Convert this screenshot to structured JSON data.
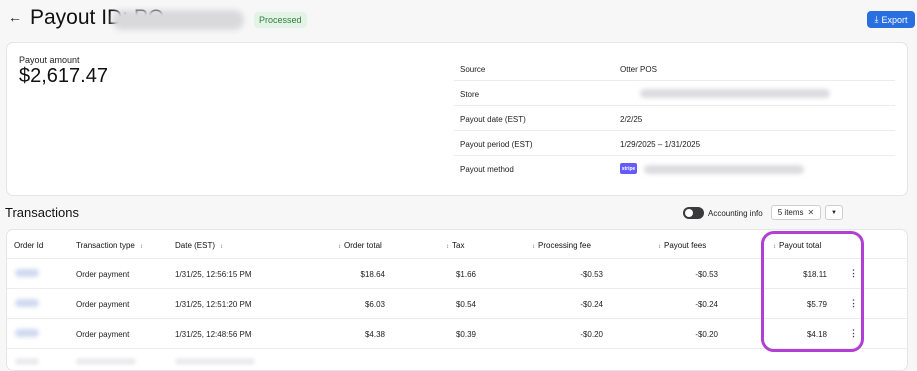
{
  "header": {
    "back_icon": "arrow-left-icon",
    "title": "Payout ID: PO-",
    "status_badge": "Processed",
    "export_label": "Export",
    "export_icon": "download-icon"
  },
  "summary": {
    "amount_label": "Payout amount",
    "amount_value": "$2,617.47",
    "details": [
      {
        "label": "Source",
        "value": "Otter POS"
      },
      {
        "label": "Store",
        "value": ""
      },
      {
        "label": "Payout date (EST)",
        "value": "2/2/25"
      },
      {
        "label": "Payout period (EST)",
        "value": "1/29/2025 – 1/31/2025"
      },
      {
        "label": "Payout method",
        "value": "",
        "logo": "stripe"
      }
    ]
  },
  "transactions": {
    "title": "Transactions",
    "accounting_info_label": "Accounting info",
    "items_chip": "5 items",
    "columns": [
      "Order Id",
      "Transaction type",
      "Date (EST)",
      "Order total",
      "Tax",
      "Processing fee",
      "Payout fees",
      "Payout total"
    ],
    "rows": [
      {
        "type": "Order payment",
        "date": "1/31/25, 12:56:15 PM",
        "order_total": "$18.64",
        "tax": "$1.66",
        "processing_fee": "-$0.53",
        "payout_fees": "-$0.53",
        "payout_total": "$18.11"
      },
      {
        "type": "Order payment",
        "date": "1/31/25, 12:51:20 PM",
        "order_total": "$6.03",
        "tax": "$0.54",
        "processing_fee": "-$0.24",
        "payout_fees": "-$0.24",
        "payout_total": "$5.79"
      },
      {
        "type": "Order payment",
        "date": "1/31/25, 12:48:56 PM",
        "order_total": "$4.38",
        "tax": "$0.39",
        "processing_fee": "-$0.20",
        "payout_fees": "-$0.20",
        "payout_total": "$4.18"
      }
    ]
  },
  "colors": {
    "accent": "#2a6fe0",
    "badge_bg": "#e3f4e6",
    "badge_text": "#2f7d3a",
    "highlight": "#b23fd4",
    "stripe": "#635bff"
  }
}
